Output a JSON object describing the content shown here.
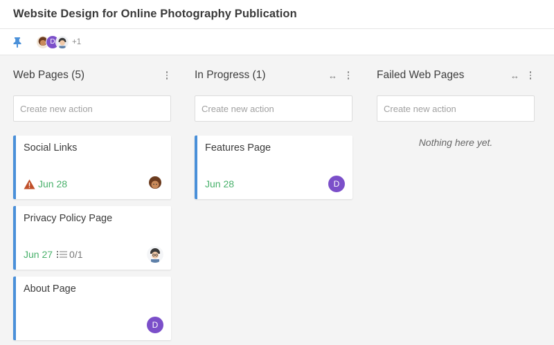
{
  "header": {
    "title": "Website Design for Online Photography Publication"
  },
  "members": {
    "avatar_initial": "D",
    "extra_count": "+1"
  },
  "columns": [
    {
      "title": "Web Pages (5)",
      "create_placeholder": "Create new action",
      "cards": [
        {
          "title": "Social Links",
          "due": "Jun 28",
          "status_icon": "warning-icon",
          "assignee": "avatar-curly-hair"
        },
        {
          "title": "Privacy Policy Page",
          "due": "Jun 27",
          "checklist": "0/1",
          "assignee": "avatar-glasses"
        },
        {
          "title": "About Page",
          "assignee_initial": "D"
        }
      ]
    },
    {
      "title": "In Progress (1)",
      "create_placeholder": "Create new action",
      "cards": [
        {
          "title": "Features Page",
          "due": "Jun 28",
          "assignee_initial": "D"
        }
      ]
    },
    {
      "title": "Failed Web Pages",
      "create_placeholder": "Create new action",
      "empty_text": "Nothing here yet."
    }
  ],
  "colors": {
    "accent_blue": "#4a90d9",
    "due_green": "#47b06a",
    "warning": "#c0502a",
    "avatar_purple": "#7b4fc9"
  }
}
